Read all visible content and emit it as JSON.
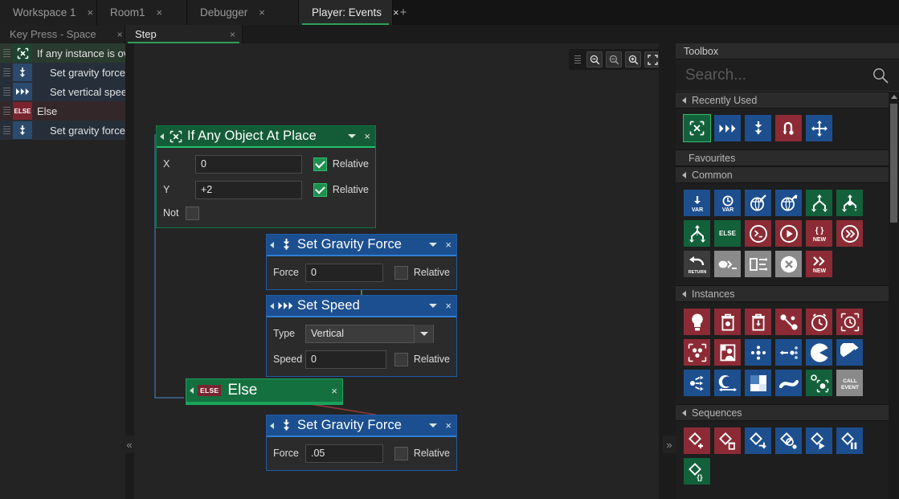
{
  "window": {
    "tabs": [
      {
        "label": "Workspace 1",
        "close": "×",
        "active": false
      },
      {
        "label": "Room1",
        "close": "×",
        "active": false
      },
      {
        "label": "Debugger",
        "close": "×",
        "active": false
      },
      {
        "label": "Player: Events",
        "close": "×",
        "active": true
      }
    ],
    "add_tab": "+"
  },
  "subtabs": [
    {
      "label": "Key Press - Space",
      "close": "×",
      "active": false
    },
    {
      "label": "Step",
      "close": "×",
      "active": true
    }
  ],
  "event_list": {
    "rows": [
      {
        "icon": "if-any-object-at-place-icon",
        "glyph": "[x]",
        "label": "If any instance is ov",
        "indent": false
      },
      {
        "icon": "set-gravity-force-icon",
        "glyph": "⤓",
        "label": "Set gravity force t",
        "indent": true
      },
      {
        "icon": "set-speed-icon",
        "glyph": "▶▶▶",
        "label": "Set vertical speed",
        "indent": true
      },
      {
        "icon": "else-icon",
        "glyph": "ELSE",
        "label": "Else",
        "indent": false
      },
      {
        "icon": "set-gravity-force-icon",
        "glyph": "⤓",
        "label": "Set gravity force t",
        "indent": true
      }
    ]
  },
  "collapse": {
    "left": "«",
    "right": "»"
  },
  "zoom_toolbar": {
    "buttons": [
      {
        "name": "zoom-out-button",
        "title": "Zoom Out"
      },
      {
        "name": "zoom-reset-button",
        "title": "Zoom 100%"
      },
      {
        "name": "zoom-in-button",
        "title": "Zoom In"
      },
      {
        "name": "zoom-fit-button",
        "title": "Fit To Screen"
      }
    ]
  },
  "blocks": [
    {
      "id": "if-any-object-at-place",
      "title": "If Any Object At Place",
      "icon_glyph": "{x}",
      "color": "green",
      "caret": "▼",
      "close": "×",
      "fields": [
        {
          "label": "X",
          "value": "0",
          "check_label": "Relative",
          "checked": true
        },
        {
          "label": "Y",
          "value": "+2",
          "check_label": "Relative",
          "checked": true
        }
      ],
      "not_label": "Not",
      "not_checked": false
    },
    {
      "id": "set-gravity-force-1",
      "title": "Set Gravity Force",
      "icon_glyph": "⤓",
      "color": "blue",
      "caret": "▼",
      "close": "×",
      "fields": [
        {
          "label": "Force",
          "value": "0",
          "check_label": "Relative",
          "checked": false
        }
      ]
    },
    {
      "id": "set-speed",
      "title": "Set Speed",
      "icon_glyph": "▶▶▶",
      "color": "blue",
      "caret": "▼",
      "close": "×",
      "type_label": "Type",
      "type_value": "Vertical",
      "fields": [
        {
          "label": "Speed",
          "value": "0",
          "check_label": "Relative",
          "checked": false
        }
      ]
    },
    {
      "id": "else",
      "title": "Else",
      "badge": "ELSE",
      "color": "green",
      "close": "×"
    },
    {
      "id": "set-gravity-force-2",
      "title": "Set Gravity Force",
      "icon_glyph": "⤓",
      "color": "blue",
      "caret": "▼",
      "close": "×",
      "fields": [
        {
          "label": "Force",
          "value": ".05",
          "check_label": "Relative",
          "checked": false
        }
      ]
    }
  ],
  "toolbox": {
    "header": "Toolbox",
    "search_placeholder": "Search...",
    "sections": [
      {
        "name": "recently-used",
        "label": "Recently Used",
        "has_tri": true,
        "items": [
          {
            "name": "if-any-object-at-place-tool",
            "color": "sel",
            "glyph": "[x]"
          },
          {
            "name": "set-speed-tool",
            "color": "blue",
            "glyph": "▶▶▶"
          },
          {
            "name": "set-gravity-force-tool",
            "color": "blue",
            "glyph": "⤓"
          },
          {
            "name": "set-gravity-direction-tool",
            "color": "red",
            "glyph": "↷"
          },
          {
            "name": "jump-to-point-tool",
            "color": "blue",
            "glyph": "✥"
          }
        ]
      },
      {
        "name": "favourites",
        "label": "Favourites",
        "has_tri": false,
        "items": []
      },
      {
        "name": "common",
        "label": "Common",
        "has_tri": true,
        "items": [
          {
            "name": "assign-variable-tool",
            "color": "blue",
            "glyph": "↓",
            "sub": "VAR"
          },
          {
            "name": "temp-variable-tool",
            "color": "blue",
            "glyph": "◴",
            "sub": "VAR"
          },
          {
            "name": "get-global-variable-tool",
            "color": "blue",
            "glyph": "↙"
          },
          {
            "name": "set-global-variable-tool",
            "color": "blue",
            "glyph": "↗"
          },
          {
            "name": "if-tool",
            "color": "green",
            "glyph": "branch"
          },
          {
            "name": "if-else-tool",
            "color": "green",
            "glyph": "branch-else"
          },
          {
            "name": "if-question-tool",
            "color": "green",
            "glyph": "branch-q"
          },
          {
            "name": "else-tool",
            "color": "green",
            "glyph": "ELSE"
          },
          {
            "name": "execute-code-tool",
            "color": "red",
            "glyph": ">_"
          },
          {
            "name": "run-tool",
            "color": "red",
            "glyph": "▶"
          },
          {
            "name": "new-struct-tool",
            "color": "red",
            "glyph": "{}",
            "sub": "NEW"
          },
          {
            "name": "skip-tool",
            "color": "red",
            "glyph": "»"
          },
          {
            "name": "return-tool",
            "color": "darkgray",
            "glyph": "↩",
            "sub": "RETURN"
          },
          {
            "name": "comment-tool",
            "color": "gray",
            "glyph": "●»_"
          },
          {
            "name": "exit-event-tool",
            "color": "gray",
            "glyph": "flow"
          },
          {
            "name": "cancel-tool",
            "color": "gray",
            "glyph": "⊗"
          },
          {
            "name": "new-array-tool",
            "color": "red",
            "glyph": "»",
            "sub": "NEW"
          }
        ]
      },
      {
        "name": "instances",
        "label": "Instances",
        "has_tri": true,
        "items": [
          {
            "name": "create-instance-tool",
            "color": "red",
            "glyph": "Ὂ1"
          },
          {
            "name": "destroy-instance-tool",
            "color": "red",
            "glyph": "trash"
          },
          {
            "name": "destroy-object-tool",
            "color": "red",
            "glyph": "trash-down"
          },
          {
            "name": "change-instance-tool",
            "color": "red",
            "glyph": "link"
          },
          {
            "name": "set-alarm-tool",
            "color": "red",
            "glyph": "clock"
          },
          {
            "name": "set-alarm-dashed-tool",
            "color": "red",
            "glyph": "clock-dashed"
          },
          {
            "name": "instance-count-tool",
            "color": "red",
            "glyph": "dots-box"
          },
          {
            "name": "instance-variable-tool",
            "color": "red",
            "glyph": "person-box"
          },
          {
            "name": "move-tool",
            "color": "blue",
            "glyph": "move-dots"
          },
          {
            "name": "move-free-tool",
            "color": "blue",
            "glyph": "move-arrow"
          },
          {
            "name": "set-direction-tool",
            "color": "blue",
            "glyph": "pac"
          },
          {
            "name": "rotate-tool",
            "color": "blue",
            "glyph": "rotate"
          },
          {
            "name": "scatter-tool",
            "color": "blue",
            "glyph": "scatter"
          },
          {
            "name": "resize-tool",
            "color": "blue",
            "glyph": "resize"
          },
          {
            "name": "sprite-tool",
            "color": "blue",
            "glyph": "sprite"
          },
          {
            "name": "path-tool",
            "color": "blue",
            "glyph": "path"
          },
          {
            "name": "applies-to-tool",
            "color": "green",
            "glyph": "applies"
          },
          {
            "name": "call-event-tool",
            "color": "gray",
            "glyph": "CALL EVENT",
            "sub": "CALL EVENT"
          }
        ]
      },
      {
        "name": "sequences",
        "label": "Sequences",
        "has_tri": true,
        "items": [
          {
            "name": "sequence-create-tool",
            "color": "red",
            "glyph": "seq-plus"
          },
          {
            "name": "sequence-destroy-tool",
            "color": "red",
            "glyph": "seq-trash"
          },
          {
            "name": "sequence-goto-tool",
            "color": "blue",
            "glyph": "seq-arrow"
          },
          {
            "name": "sequence-loop-tool",
            "color": "blue",
            "glyph": "seq-loop"
          },
          {
            "name": "sequence-play-tool",
            "color": "blue",
            "glyph": "seq-play"
          },
          {
            "name": "sequence-pause-tool",
            "color": "blue",
            "glyph": "seq-pause"
          },
          {
            "name": "sequence-variable-tool",
            "color": "green",
            "glyph": "seq-var"
          }
        ]
      }
    ]
  }
}
